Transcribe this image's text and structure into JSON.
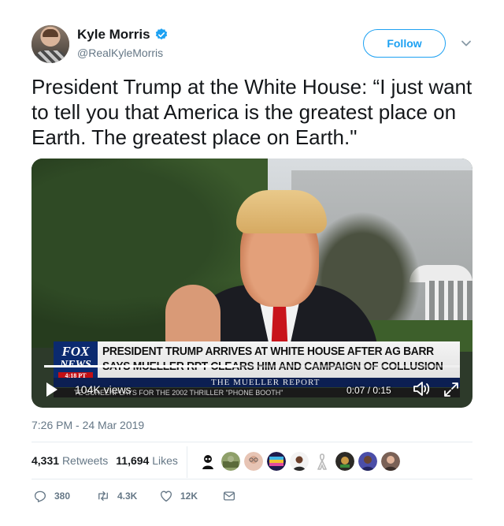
{
  "user": {
    "display_name": "Kyle Morris",
    "handle": "@RealKyleMorris",
    "verified": true
  },
  "follow_label": "Follow",
  "tweet": {
    "text": "President Trump at the White House: “I just want to tell you that America is the greatest place on Earth. The greatest place on Earth.\"",
    "timestamp": "7:26 PM - 24 Mar 2019"
  },
  "video": {
    "chyron_logo_line1": "FOX",
    "chyron_logo_line2": "NEWS",
    "chyron_logo_time": "4:18 PT",
    "chyron_headline_1": "PRESIDENT TRUMP ARRIVES AT WHITE HOUSE AFTER AG BARR",
    "chyron_headline_2": "SAYS MUELLER RPT CLEARS HIM AND CAMPAIGN OF COLLUSION",
    "chyron_band": "THE MUELLER REPORT",
    "ticker": "TE SCREENPLAYS FOR THE 2002 THRILLER \"PHONE BOOTH\"",
    "views": "104K views",
    "time": "0:07 / 0:15",
    "progress": 0.47
  },
  "stats": {
    "retweets_count": "4,331",
    "retweets_label": "Retweets",
    "likes_count": "11,694",
    "likes_label": "Likes"
  },
  "actions": {
    "replies": "380",
    "retweets": "4.3K",
    "likes": "12K"
  },
  "colors": {
    "accent": "#1da1f2",
    "secondary_text": "#657786",
    "primary_text": "#14171a"
  }
}
